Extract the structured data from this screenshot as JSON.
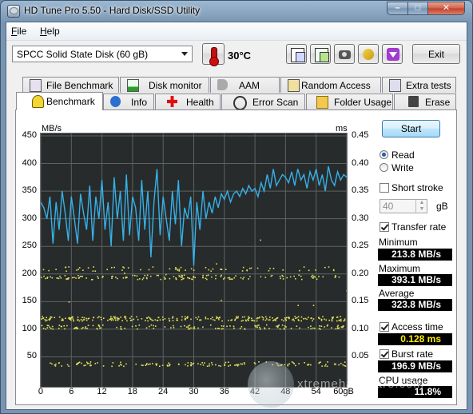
{
  "window": {
    "title": "HD Tune Pro 5.50 - Hard Disk/SSD Utility",
    "caption_buttons": {
      "minimize": "–",
      "maximize": "□",
      "close": "✕"
    }
  },
  "menu": {
    "file": "File",
    "file_key": "F",
    "help": "Help",
    "help_key": "H"
  },
  "toolbar": {
    "disk_select": "SPCC Solid State Disk (60 gB)",
    "temperature": "30°C",
    "icons": [
      "copy-icon",
      "save-icon",
      "screenshot-icon",
      "options-icon",
      "download-icon"
    ],
    "exit_label": "Exit"
  },
  "tabs_top": [
    "File Benchmark",
    "Disk monitor",
    "AAM",
    "Random Access",
    "Extra tests"
  ],
  "tabs_bottom": [
    "Benchmark",
    "Info",
    "Health",
    "Error Scan",
    "Folder Usage",
    "Erase"
  ],
  "active_tab": "Benchmark",
  "sidebar": {
    "start_label": "Start",
    "read_label": "Read",
    "write_label": "Write",
    "short_stroke_label": "Short stroke",
    "short_stroke_value": "40",
    "short_stroke_unit": "gB",
    "transfer_rate_label": "Transfer rate",
    "minimum_label": "Minimum",
    "minimum_value": "213.8 MB/s",
    "maximum_label": "Maximum",
    "maximum_value": "393.1 MB/s",
    "average_label": "Average",
    "average_value": "323.8 MB/s",
    "access_time_label": "Access time",
    "access_time_value": "0.128 ms",
    "burst_rate_label": "Burst rate",
    "burst_rate_value": "196.9 MB/s",
    "cpu_usage_label": "CPU usage",
    "cpu_usage_value": "11.8%"
  },
  "colors": {
    "chart_bg": "#272b2b",
    "grid": "#5d6262",
    "transfer_line": "#36b0e8",
    "access_points": "#e3e35a"
  },
  "watermark": "xtremehardware.com",
  "chart_data": {
    "type": "line",
    "ylabel": "MB/s",
    "y2label": "ms",
    "xlim": [
      0,
      60
    ],
    "ylim": [
      0,
      450
    ],
    "y2lim": [
      0,
      0.45
    ],
    "x_ticks": [
      "0",
      "6",
      "12",
      "18",
      "24",
      "30",
      "36",
      "42",
      "48",
      "54",
      "60gB"
    ],
    "y_ticks": [
      "450",
      "400",
      "350",
      "300",
      "250",
      "200",
      "150",
      "100",
      "50"
    ],
    "y2_ticks": [
      "0.45",
      "0.40",
      "0.35",
      "0.30",
      "0.25",
      "0.20",
      "0.15",
      "0.10",
      "0.05"
    ],
    "grid": true,
    "series": [
      {
        "name": "Transfer rate",
        "x": [
          0,
          0.6,
          1.2,
          1.8,
          2.4,
          3,
          3.6,
          4.2,
          4.8,
          5.4,
          6,
          6.6,
          7.2,
          7.8,
          8.4,
          9,
          9.6,
          10.2,
          10.8,
          11.4,
          12,
          12.6,
          13.2,
          13.8,
          14.4,
          15,
          15.6,
          16.2,
          16.8,
          17.4,
          18,
          18.6,
          19.2,
          19.8,
          20.4,
          21,
          21.6,
          22.2,
          22.8,
          23.4,
          24,
          24.6,
          25.2,
          25.8,
          26.4,
          27,
          27.6,
          28.2,
          28.8,
          29.4,
          30,
          30.6,
          31.2,
          31.8,
          32.4,
          33,
          33.6,
          34.2,
          34.8,
          35.4,
          36,
          36.6,
          37.2,
          37.8,
          38.4,
          39,
          39.6,
          40.2,
          40.8,
          41.4,
          42,
          42.6,
          43.2,
          43.8,
          44.4,
          45,
          45.6,
          46.2,
          46.8,
          47.4,
          48,
          48.6,
          49.2,
          49.8,
          50.4,
          51,
          51.6,
          52.2,
          52.8,
          53.4,
          54,
          54.6,
          55.2,
          55.8,
          56.4,
          57,
          57.6,
          58.2,
          58.8,
          59.4,
          60
        ],
        "values": [
          330,
          320,
          300,
          340,
          255,
          330,
          280,
          350,
          310,
          260,
          340,
          300,
          255,
          345,
          310,
          280,
          360,
          260,
          340,
          300,
          370,
          280,
          330,
          250,
          375,
          300,
          350,
          260,
          380,
          270,
          340,
          320,
          260,
          370,
          280,
          350,
          230,
          330,
          390,
          270,
          340,
          300,
          260,
          350,
          290,
          370,
          250,
          320,
          300,
          340,
          215,
          330,
          280,
          350,
          300,
          330,
          310,
          340,
          320,
          345,
          335,
          350,
          330,
          345,
          350,
          340,
          355,
          345,
          360,
          350,
          355,
          340,
          365,
          350,
          380,
          355,
          390,
          360,
          370,
          380,
          375,
          365,
          385,
          360,
          390,
          370,
          380,
          355,
          385,
          370,
          390,
          360,
          380,
          350,
          395,
          370,
          360,
          385,
          370,
          380,
          375
        ],
        "color": "#36b0e8"
      },
      {
        "name": "Access time",
        "bands_ms": [
          0.21,
          0.195,
          0.12,
          0.105,
          0.038
        ],
        "color": "#e3e35a"
      }
    ]
  }
}
